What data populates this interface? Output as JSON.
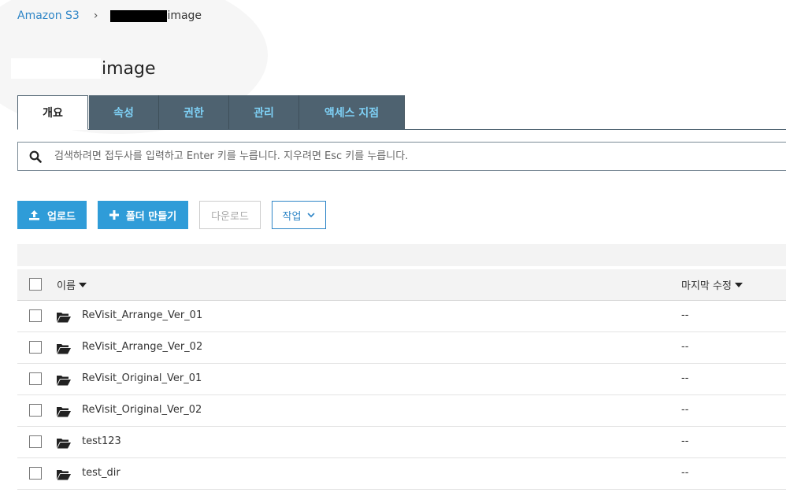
{
  "breadcrumb": {
    "root": "Amazon S3",
    "separator": "›",
    "current_suffix": "image"
  },
  "title": {
    "suffix": "image"
  },
  "tabs": [
    {
      "label": "개요",
      "active": true
    },
    {
      "label": "속성",
      "active": false
    },
    {
      "label": "권한",
      "active": false
    },
    {
      "label": "관리",
      "active": false
    },
    {
      "label": "액세스 지점",
      "active": false
    }
  ],
  "search": {
    "placeholder": "검색하려면 접두사를 입력하고 Enter 키를 누릅니다. 지우려면 Esc 키를 누릅니다.",
    "icon": "search-icon"
  },
  "toolbar": {
    "upload": "업로드",
    "create_folder": "폴더 만들기",
    "download": "다운로드",
    "actions": "작업"
  },
  "table": {
    "columns": {
      "name": "이름",
      "last_modified": "마지막 수정"
    },
    "rows": [
      {
        "name": "ReVisit_Arrange_Ver_01",
        "modified": "--",
        "icon": "folder-open-icon"
      },
      {
        "name": "ReVisit_Arrange_Ver_02",
        "modified": "--",
        "icon": "folder-open-icon"
      },
      {
        "name": "ReVisit_Original_Ver_01",
        "modified": "--",
        "icon": "folder-open-icon"
      },
      {
        "name": "ReVisit_Original_Ver_02",
        "modified": "--",
        "icon": "folder-open-icon"
      },
      {
        "name": "test123",
        "modified": "--",
        "icon": "folder-open-icon"
      },
      {
        "name": "test_dir",
        "modified": "--",
        "icon": "folder-open-icon"
      }
    ]
  },
  "colors": {
    "link": "#2f86c7",
    "primary": "#2f9cd8",
    "tab_bg": "#4e6270",
    "tab_text": "#7ed0f5"
  }
}
